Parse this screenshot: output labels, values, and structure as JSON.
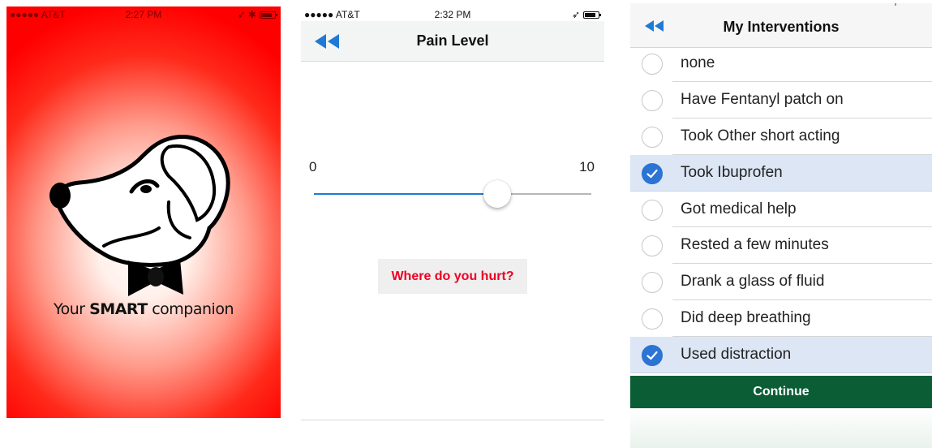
{
  "accent_blue": "#1f7ad4",
  "brand_red": "#ff0000",
  "continue_green": "#0a5d35",
  "splash": {
    "status": {
      "carrier": "●●●●● AT&T",
      "time": "2:27 PM"
    },
    "logo_icon": "dog-with-bowtie-icon",
    "tagline_pre": "Your ",
    "tagline_bold": "SMART",
    "tagline_post": " companion"
  },
  "pain_level": {
    "status": {
      "carrier": "●●●●● AT&T",
      "time": "2:32 PM"
    },
    "title": "Pain Level",
    "back_icon": "double-chevron-left-icon",
    "slider": {
      "min_label": "0",
      "max_label": "10",
      "min": 0,
      "max": 10,
      "value": 6.6
    },
    "hurt_button": "Where do you hurt?"
  },
  "interventions": {
    "title": "My Interventions",
    "back_icon": "double-chevron-left-icon",
    "items": [
      {
        "label": "none",
        "checked": false
      },
      {
        "label": "Have Fentanyl patch on",
        "checked": false
      },
      {
        "label": "Took Other short acting",
        "checked": false
      },
      {
        "label": "Took Ibuprofen",
        "checked": true
      },
      {
        "label": "Got medical help",
        "checked": false
      },
      {
        "label": "Rested a few minutes",
        "checked": false
      },
      {
        "label": "Drank a glass of fluid",
        "checked": false
      },
      {
        "label": "Did deep breathing",
        "checked": false
      },
      {
        "label": "Used distraction",
        "checked": true
      }
    ],
    "continue_label": "Continue"
  }
}
